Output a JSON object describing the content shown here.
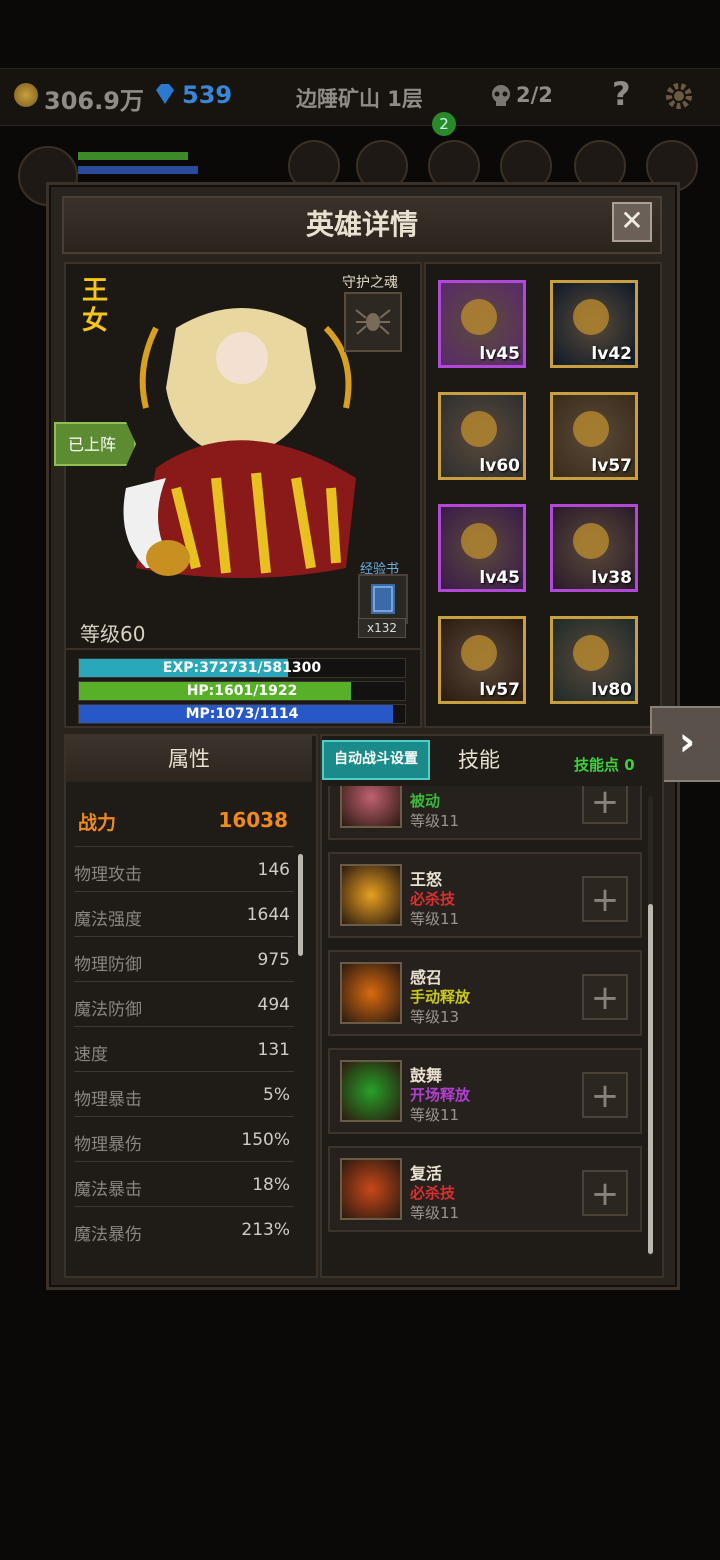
{
  "topbar": {
    "gold": "306.9万",
    "gems": "539",
    "stage": "边陲矿山 1层",
    "skulls": "2/2",
    "help": "?",
    "badge": "2"
  },
  "panel": {
    "title": "英雄详情",
    "close": "✕"
  },
  "hero": {
    "name": "王女",
    "guardian_label": "守护之魂",
    "deployed": "已上阵",
    "expbook_label": "经验书",
    "expbook_count": "x132",
    "level": "等级60",
    "exp": "EXP:372731/581300",
    "hp": "HP:1601/1922",
    "mp": "MP:1073/1114",
    "exp_fraction": 0.641,
    "hp_fraction": 0.833,
    "mp_fraction": 0.964
  },
  "equipment": [
    {
      "name": "horned-helmet-icon",
      "level": "lv45",
      "rarity": "purple"
    },
    {
      "name": "necklace-icon",
      "level": "lv42",
      "rarity": "gold"
    },
    {
      "name": "chest-armor-icon",
      "level": "lv60",
      "rarity": "gold"
    },
    {
      "name": "boots-icon",
      "level": "lv57",
      "rarity": "gold"
    },
    {
      "name": "ring-icon",
      "level": "lv45",
      "rarity": "purple"
    },
    {
      "name": "gem-ring-icon",
      "level": "lv38",
      "rarity": "purple"
    },
    {
      "name": "horn-icon",
      "level": "lv57",
      "rarity": "gold"
    },
    {
      "name": "shield-icon",
      "level": "lv80",
      "rarity": "gold"
    }
  ],
  "attributes": {
    "tab": "属性",
    "power_label": "战力",
    "power_value": "16038",
    "rows": [
      {
        "name": "物理攻击",
        "value": "146"
      },
      {
        "name": "魔法强度",
        "value": "1644"
      },
      {
        "name": "物理防御",
        "value": "975"
      },
      {
        "name": "魔法防御",
        "value": "494"
      },
      {
        "name": "速度",
        "value": "131"
      },
      {
        "name": "物理暴击",
        "value": "5%"
      },
      {
        "name": "物理暴伤",
        "value": "150%"
      },
      {
        "name": "魔法暴击",
        "value": "18%"
      },
      {
        "name": "魔法暴伤",
        "value": "213%"
      }
    ]
  },
  "skills": {
    "auto_button": "自动战斗设置",
    "tab": "技能",
    "points": "技能点 0",
    "plus": "+",
    "list": [
      {
        "name": "",
        "type": "被动",
        "type_color": "#3cb83c",
        "level": "等级11"
      },
      {
        "name": "王怒",
        "type": "必杀技",
        "type_color": "#d83030",
        "level": "等级11"
      },
      {
        "name": "感召",
        "type": "手动释放",
        "type_color": "#c8c820",
        "level": "等级13"
      },
      {
        "name": "鼓舞",
        "type": "开场释放",
        "type_color": "#b040d0",
        "level": "等级11"
      },
      {
        "name": "复活",
        "type": "必杀技",
        "type_color": "#d83030",
        "level": "等级11"
      }
    ]
  },
  "colors": {
    "purple_border": "#b048d8",
    "gold_border": "#c8a040",
    "exp": "#28a8b8",
    "hp": "#58b028",
    "mp": "#2858c8",
    "power": "#f08a20"
  }
}
